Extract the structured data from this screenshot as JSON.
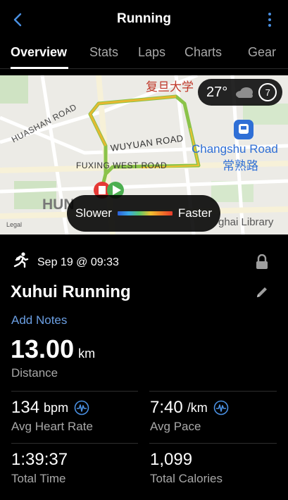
{
  "header": {
    "title": "Running",
    "back_icon": "chevron-left-icon",
    "more_icon": "kebab-menu-icon",
    "accent": "#4a90e2"
  },
  "tabs": [
    {
      "label": "Overview",
      "active": true
    },
    {
      "label": "Stats",
      "active": false
    },
    {
      "label": "Laps",
      "active": false
    },
    {
      "label": "Charts",
      "active": false
    },
    {
      "label": "Gear",
      "active": false
    }
  ],
  "map": {
    "labels": {
      "huashan": "HUASHAN ROAD",
      "wuyuan": "WUYUAN ROAD",
      "fuxing": "FUXING WEST ROAD",
      "changshu_en": "Changshu Road",
      "changshu_cn": "常熟路",
      "fudan": "复旦大学",
      "hun": "HUN",
      "library": "ghai Library",
      "legal": "Legal"
    },
    "weather": {
      "temp": "27°",
      "condition_icon": "cloud-icon",
      "aqi": "7"
    },
    "legend": {
      "slower": "Slower",
      "faster": "Faster"
    },
    "route_colors": [
      "#e8b830",
      "#8bc34a",
      "#f07a28"
    ]
  },
  "activity": {
    "type_icon": "runner-icon",
    "date": "Sep 19 @ 09:33",
    "name": "Xuhui Running",
    "add_notes": "Add Notes",
    "distance_value": "13.00",
    "distance_unit": "km",
    "distance_label": "Distance"
  },
  "stats": {
    "heart_rate": {
      "value": "134",
      "unit": "bpm",
      "label": "Avg Heart Rate"
    },
    "pace": {
      "value": "7:40",
      "unit": "/km",
      "label": "Avg Pace"
    },
    "time": {
      "value": "1:39:37",
      "label": "Total Time"
    },
    "calories": {
      "value": "1,099",
      "label": "Total Calories"
    }
  }
}
